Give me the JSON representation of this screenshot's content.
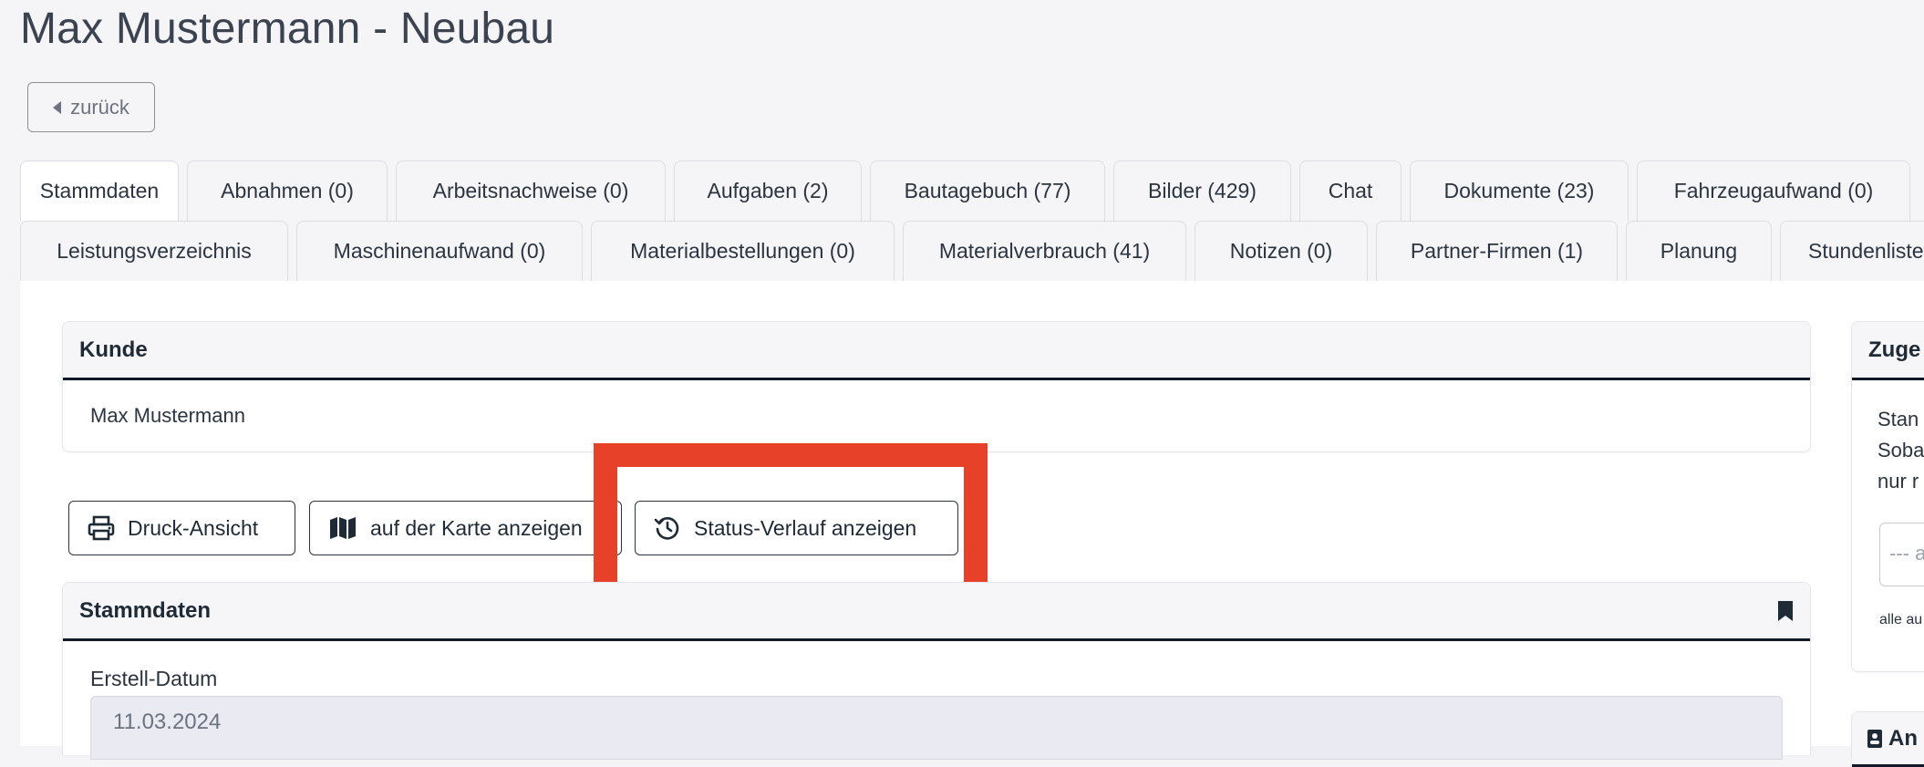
{
  "page": {
    "title": "Max Mustermann - Neubau"
  },
  "back_button": {
    "label": "zurück"
  },
  "tabs_row1": [
    {
      "label": "Stammdaten",
      "active": true
    },
    {
      "label": "Abnahmen (0)"
    },
    {
      "label": "Arbeitsnachweise (0)"
    },
    {
      "label": "Aufgaben (2)"
    },
    {
      "label": "Bautagebuch (77)"
    },
    {
      "label": "Bilder (429)"
    },
    {
      "label": "Chat"
    },
    {
      "label": "Dokumente (23)"
    },
    {
      "label": "Fahrzeugaufwand (0)"
    }
  ],
  "tabs_row2": [
    {
      "label": "Leistungsverzeichnis"
    },
    {
      "label": "Maschinenaufwand (0)"
    },
    {
      "label": "Materialbestellungen (0)"
    },
    {
      "label": "Materialverbrauch (41)"
    },
    {
      "label": "Notizen (0)"
    },
    {
      "label": "Partner-Firmen (1)"
    },
    {
      "label": "Planung"
    },
    {
      "label": "Stundenliste"
    }
  ],
  "kunde": {
    "title": "Kunde",
    "name": "Max Mustermann"
  },
  "actions": {
    "print": "Druck-Ansicht",
    "map": "auf der Karte anzeigen",
    "status": "Status-Verlauf anzeigen"
  },
  "stammdaten": {
    "title": "Stammdaten",
    "created_label": "Erstell-Datum",
    "created_value": "11.03.2024"
  },
  "side_panel": {
    "title": "Zuge",
    "lines": [
      "Stan",
      "Soba",
      "nur r"
    ],
    "select_placeholder": "--- a",
    "small_text": "alle au"
  },
  "side_panel2": {
    "title": "An"
  },
  "colors": {
    "highlight": "#e8412a",
    "header_border": "#111827"
  }
}
